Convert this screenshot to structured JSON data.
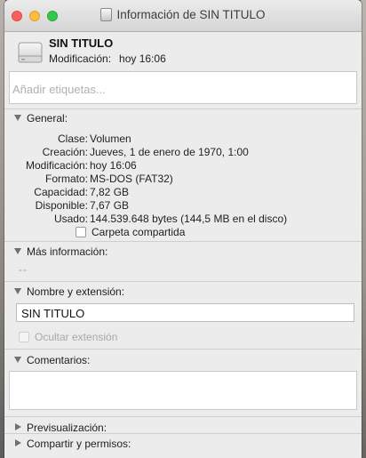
{
  "window": {
    "title": "Información de SIN TITULO"
  },
  "header": {
    "volume_name": "SIN TITULO",
    "modified_label": "Modificación:",
    "modified_value": "hoy 16:06"
  },
  "tags": {
    "placeholder": "Añadir etiquetas..."
  },
  "sections": {
    "general": {
      "label": "General:",
      "rows": [
        {
          "key": "Clase:",
          "value": "Volumen"
        },
        {
          "key": "Creación:",
          "value": "Jueves, 1 de enero de 1970, 1:00"
        },
        {
          "key": "Modificación:",
          "value": "hoy 16:06"
        },
        {
          "key": "Formato:",
          "value": "MS-DOS (FAT32)"
        },
        {
          "key": "Capacidad:",
          "value": "7,82 GB"
        },
        {
          "key": "Disponible:",
          "value": "7,67 GB"
        },
        {
          "key": "Usado:",
          "value": "144.539.648 bytes (144,5 MB en el disco)"
        }
      ],
      "shared_folder_label": "Carpeta compartida"
    },
    "more_info": {
      "label": "Más información:",
      "value": "--"
    },
    "name_ext": {
      "label": "Nombre y extensión:",
      "name_value": "SIN TITULO",
      "hide_ext_label": "Ocultar extensión"
    },
    "comments": {
      "label": "Comentarios:"
    },
    "preview": {
      "label": "Previsualización:"
    },
    "sharing": {
      "label": "Compartir y permisos:"
    }
  },
  "colors": {
    "window_bg": "#ececec",
    "close": "#fc605c",
    "minimize": "#fdbc40",
    "maximize": "#34c84a"
  }
}
